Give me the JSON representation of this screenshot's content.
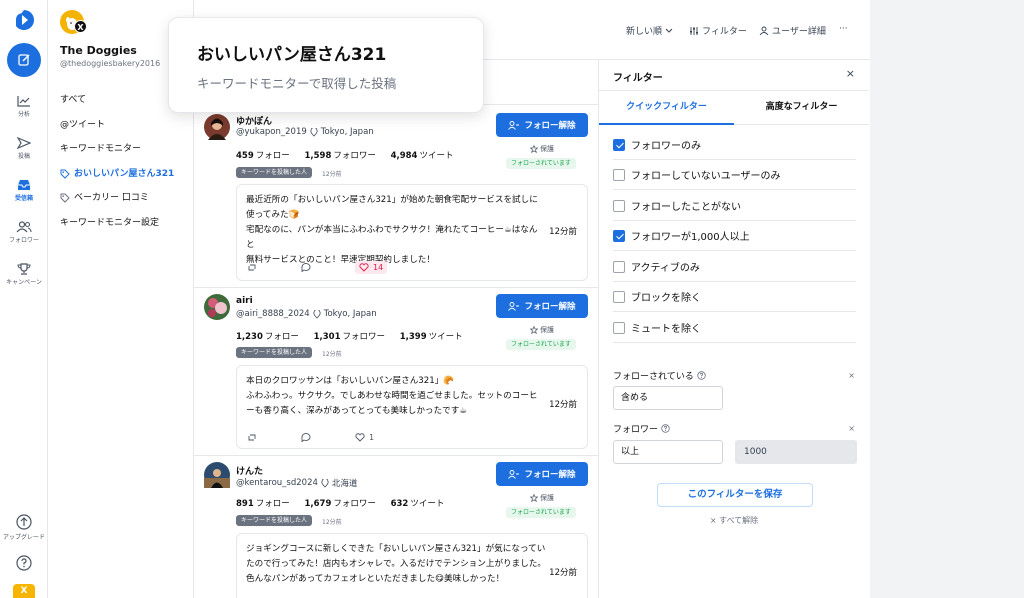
{
  "rail": {
    "items": [
      {
        "label": "分析",
        "icon": "chart-icon"
      },
      {
        "label": "投稿",
        "icon": "send-icon"
      },
      {
        "label": "受信箱",
        "icon": "inbox-icon"
      },
      {
        "label": "フォロワー",
        "icon": "users-icon"
      },
      {
        "label": "キャンペーン",
        "icon": "trophy-icon"
      }
    ],
    "upgrade_label": "アップグレード",
    "help_icon": "question-icon",
    "bottom_badge": "X"
  },
  "account": {
    "name": "The Doggies",
    "handle": "@thedoggiesbakery2016",
    "badge": "X",
    "nav": [
      {
        "label": "すべて"
      },
      {
        "label": "@ツイート"
      },
      {
        "label": "キーワードモニター"
      },
      {
        "label": "おいしいパン屋さん321"
      },
      {
        "label": "ベーカリー 口コミ"
      },
      {
        "label": "キーワードモニター設定"
      }
    ]
  },
  "topbar": {
    "sort_label": "新しい順",
    "filter_label": "フィルター",
    "user_detail_label": "ユーザー詳細",
    "more": "···"
  },
  "tooltip": {
    "title": "おいしいパン屋さん321",
    "subtitle": "キーワードモニターで取得した投稿"
  },
  "posts": [
    {
      "name": "ゆかぽん",
      "handle": "@yukapon_2019",
      "location": "Tokyo, Japan",
      "following": "459",
      "followers": "1,598",
      "tweets": "4,984",
      "following_label": "フォロー",
      "followers_label": "フォロワー",
      "tweets_label": "ツイート",
      "tag": "キーワードを投稿した人",
      "tag_time": "12分前",
      "unfollow_label": "フォロー解除",
      "protect_label": "保護",
      "followed_badge": "フォローされています",
      "text": [
        "最近近所の「おいしいパン屋さん321」が始めた朝食宅配サービスを試しに",
        "使ってみた🍞",
        "宅配なのに、パンが本当にふわふわでサクサク！淹れたてコーヒー☕はなんと",
        "無料サービスとのこと！早速定期契約しました！"
      ],
      "time": "12分前",
      "likes": "14",
      "avatar_color": "#7a3b2e"
    },
    {
      "name": "airi",
      "handle": "@airi_8888_2024",
      "location": "Tokyo, Japan",
      "following": "1,230",
      "followers": "1,301",
      "tweets": "1,399",
      "following_label": "フォロー",
      "followers_label": "フォロワー",
      "tweets_label": "ツイート",
      "tag": "キーワードを投稿した人",
      "tag_time": "12分前",
      "unfollow_label": "フォロー解除",
      "protect_label": "保護",
      "followed_badge": "フォローされています",
      "text": [
        "本日のクロワッサンは「おいしいパン屋さん321」🥐",
        "ふわふわっ。サクサク。でしあわせな時間を過ごせました。セットのコーヒ",
        "ーも香り高く、深みがあってとっても美味しかったです☕"
      ],
      "time": "12分前",
      "likes": "1",
      "avatar_color": "#3f6b3a"
    },
    {
      "name": "けんた",
      "handle": "@kentarou_sd2024",
      "location": "北海道",
      "following": "891",
      "followers": "1,679",
      "tweets": "632",
      "following_label": "フォロー",
      "followers_label": "フォロワー",
      "tweets_label": "ツイート",
      "tag": "キーワードを投稿した人",
      "tag_time": "12分前",
      "unfollow_label": "フォロー解除",
      "protect_label": "保護",
      "followed_badge": "フォローされています",
      "text": [
        "ジョギングコースに新しくできた「おいしいパン屋さん321」が気になってい",
        "たので行ってみた！店内もオシャレで。入るだけでテンション上がりました。",
        "色んなパンがあってカフェオレといただきました😋美味しかった！"
      ],
      "time": "12分前",
      "likes": "",
      "avatar_color": "#2c4b6e"
    }
  ],
  "filter": {
    "title": "フィルター",
    "close": "×",
    "tabs": [
      {
        "label": "クイックフィルター"
      },
      {
        "label": "高度なフィルター"
      }
    ],
    "options": [
      {
        "label": "フォロワーのみ",
        "checked": true
      },
      {
        "label": "フォローしていないユーザーのみ",
        "checked": false
      },
      {
        "label": "フォローしたことがない",
        "checked": false
      },
      {
        "label": "フォロワーが1,000人以上",
        "checked": true
      },
      {
        "label": "アクティブのみ",
        "checked": false
      },
      {
        "label": "ブロックを除く",
        "checked": false
      },
      {
        "label": "ミュートを除く",
        "checked": false
      }
    ],
    "followed_label": "フォローされている",
    "followed_value": "含める",
    "follower_label": "フォロワー",
    "follower_op": "以上",
    "follower_value": "1000",
    "clear_x": "×",
    "save_label": "このフィルターを保存",
    "clear_all_label": "× すべて解除"
  },
  "colors": {
    "accent": "#1d6fe0",
    "brand_yellow": "#f5b301"
  }
}
